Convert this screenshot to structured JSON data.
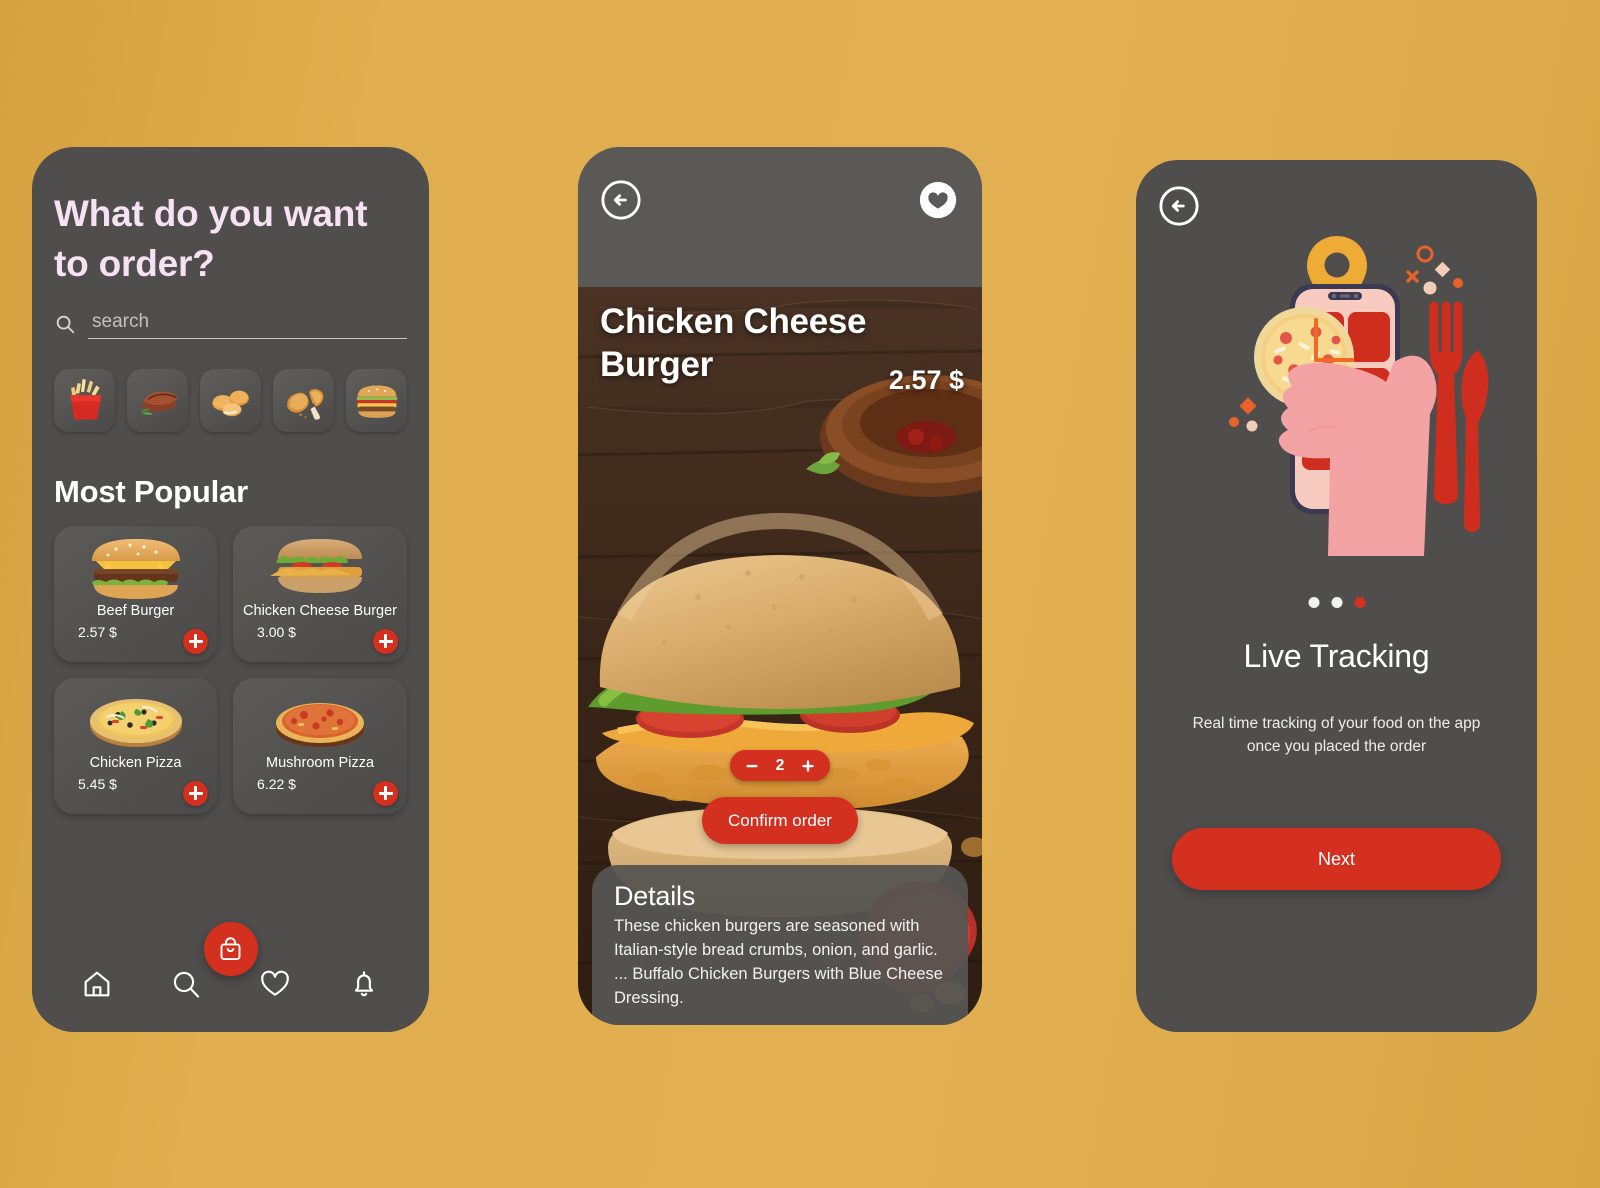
{
  "theme": {
    "background": "#e0ae4e",
    "phone_body": "#4f4e4c",
    "accent_red": "#d4301f",
    "heading_pink": "#f6e2f2",
    "text_white": "#ffffff"
  },
  "home": {
    "title": "What do you want to order?",
    "search": {
      "value": "",
      "placeholder": "search"
    },
    "categories": [
      {
        "name": "fries",
        "icon": "fries-icon"
      },
      {
        "name": "sausages",
        "icon": "sausage-icon"
      },
      {
        "name": "nuggets",
        "icon": "nuggets-icon"
      },
      {
        "name": "fried chicken",
        "icon": "fried-chicken-icon"
      },
      {
        "name": "burger",
        "icon": "burger-icon"
      }
    ],
    "section_title": "Most Popular",
    "products": [
      {
        "name": "Beef Burger",
        "price": "2.57 $",
        "icon": "beef-burger-image",
        "add_label": "+"
      },
      {
        "name": "Chicken Cheese Burger",
        "price": "3.00 $",
        "icon": "chicken-cheese-burger-image",
        "add_label": "+"
      },
      {
        "name": "Chicken Pizza",
        "price": "5.45 $",
        "icon": "chicken-pizza-image",
        "add_label": "+"
      },
      {
        "name": "Mushroom Pizza",
        "price": "6.22 $",
        "icon": "mushroom-pizza-image",
        "add_label": "+"
      }
    ],
    "nav": [
      {
        "name": "home",
        "icon": "home-icon"
      },
      {
        "name": "search",
        "icon": "search-icon"
      },
      {
        "name": "favorites",
        "icon": "heart-icon"
      },
      {
        "name": "notifications",
        "icon": "bell-icon"
      }
    ],
    "cart_fab": {
      "icon": "shopping-bag-icon"
    }
  },
  "detail": {
    "back_icon": "arrow-left-circle-icon",
    "favorite_icon": "heart-filled-circle-icon",
    "title": "Chicken Cheese Burger",
    "price": "2.57 $",
    "quantity": "2",
    "decrement_label": "−",
    "increment_label": "+",
    "confirm_label": "Confirm order",
    "details_heading": "Details",
    "details_text": "These chicken burgers are seasoned with Italian-style bread crumbs, onion, and garlic. ... Buffalo Chicken Burgers with Blue Cheese Dressing."
  },
  "tracking": {
    "back_icon": "arrow-left-circle-icon",
    "illustration": "hand-holding-phone-with-pizza-location-pin-fork-knife",
    "dots": [
      {
        "active": false
      },
      {
        "active": false
      },
      {
        "active": true
      }
    ],
    "title": "Live Tracking",
    "description": "Real time tracking of your food on the app once you placed the order",
    "next_label": "Next"
  }
}
